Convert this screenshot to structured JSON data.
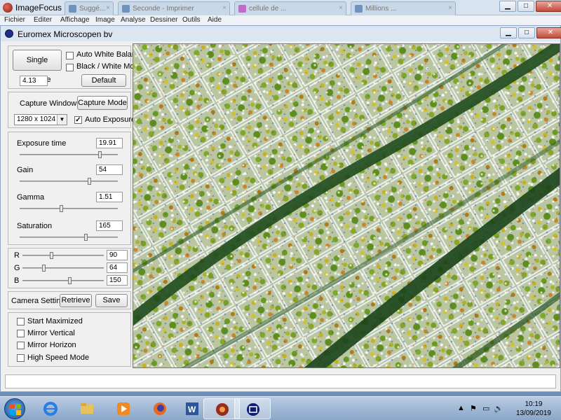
{
  "outer_window": {
    "title": "ImageFocus",
    "tabs": [
      "Suggé...",
      "Seconde - Imprimer",
      "cellule de ...",
      "Millions ..."
    ],
    "menu": [
      "Fichier",
      "Editer",
      "Affichage",
      "Image",
      "Analyse",
      "Dessiner",
      "Outils",
      "Aide"
    ],
    "buttons": {
      "minimize": "▁",
      "maximize": "□",
      "close": "✕"
    }
  },
  "window": {
    "title": "Euromex Microscopen bv",
    "buttons": {
      "minimize": "▁",
      "maximize": "□",
      "close": "✕"
    }
  },
  "capture": {
    "single_capture_label": "Single Capture",
    "auto_white_balance_label": "Auto White Balance",
    "auto_white_balance_checked": false,
    "bw_mode_label": "Black / White Mode",
    "bw_mode_checked": false,
    "value": "4.13",
    "default_label": "Default"
  },
  "capture_window": {
    "label": "Capture Window",
    "capture_mode_label": "Capture Mode",
    "resolution": "1280 x 1024",
    "auto_exposure_label": "Auto Exposure",
    "auto_exposure_checked": true
  },
  "sliders": [
    {
      "label": "Exposure time",
      "value": "19.91",
      "level": 0.83
    },
    {
      "label": "Gain",
      "value": "54",
      "level": 0.72
    },
    {
      "label": "Gamma",
      "value": "1.51",
      "level": 0.42
    },
    {
      "label": "Saturation",
      "value": "165",
      "level": 0.68
    }
  ],
  "rgb": [
    {
      "label": "R",
      "value": "90",
      "level": 0.35
    },
    {
      "label": "G",
      "value": "64",
      "level": 0.25
    },
    {
      "label": "B",
      "value": "150",
      "level": 0.59
    }
  ],
  "camera_settings": {
    "label": "Camera Settings",
    "retrieve_label": "Retrieve",
    "save_label": "Save"
  },
  "options": [
    {
      "label": "Start Maximized",
      "checked": false
    },
    {
      "label": "Mirror Vertical",
      "checked": false
    },
    {
      "label": "Mirror Horizon",
      "checked": false
    },
    {
      "label": "High Speed Mode",
      "checked": false
    }
  ],
  "taskbar": {
    "apps": [
      "start",
      "internet-explorer",
      "file-explorer",
      "media-player",
      "firefox",
      "word",
      "imagefocus",
      "euromex"
    ],
    "time": "10:19",
    "date": "13/09/2019"
  }
}
